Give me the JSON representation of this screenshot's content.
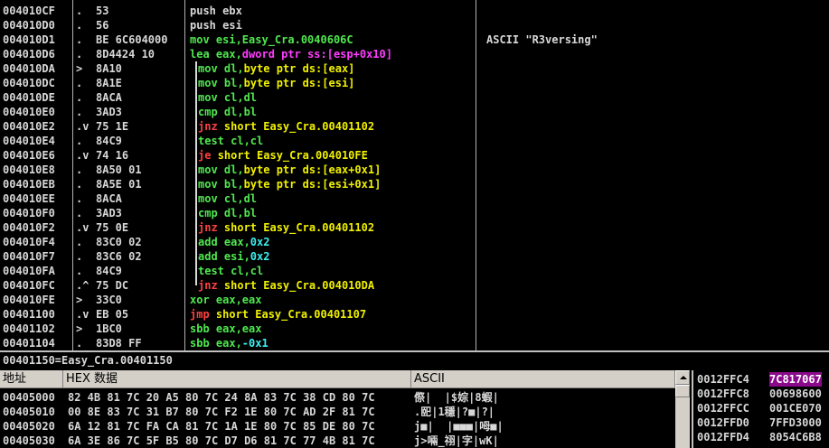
{
  "disasm": {
    "rows": [
      {
        "addr": "004010CF",
        "mark": ".",
        "hex": "53",
        "asm": [
          [
            "w",
            "push ebx"
          ]
        ],
        "comment": ""
      },
      {
        "addr": "004010D0",
        "mark": ".",
        "hex": "56",
        "asm": [
          [
            "w",
            "push esi"
          ]
        ],
        "comment": ""
      },
      {
        "addr": "004010D1",
        "mark": ".",
        "hex": "BE 6C604000",
        "asm": [
          [
            "g",
            "mov esi,Easy_Cra.0040606C"
          ]
        ],
        "comment": "ASCII \"R3versing\""
      },
      {
        "addr": "004010D6",
        "mark": ".",
        "hex": "8D4424 10",
        "asm": [
          [
            "g",
            "lea eax,"
          ],
          [
            "m",
            "dword ptr ss:[esp+0x10]"
          ]
        ],
        "comment": ""
      },
      {
        "addr": "004010DA",
        "mark": ">",
        "hex": "8A10",
        "asm": [
          [
            "g",
            "mov dl,"
          ],
          [
            "y",
            "byte ptr ds:[eax]"
          ]
        ],
        "comment": ""
      },
      {
        "addr": "004010DC",
        "mark": ".",
        "hex": "8A1E",
        "asm": [
          [
            "g",
            "mov bl,"
          ],
          [
            "y",
            "byte ptr ds:[esi]"
          ]
        ],
        "comment": ""
      },
      {
        "addr": "004010DE",
        "mark": ".",
        "hex": "8ACA",
        "asm": [
          [
            "g",
            "mov cl,dl"
          ]
        ],
        "comment": ""
      },
      {
        "addr": "004010E0",
        "mark": ".",
        "hex": "3AD3",
        "asm": [
          [
            "g",
            "cmp dl,bl"
          ]
        ],
        "comment": ""
      },
      {
        "addr": "004010E2",
        "mark": ".v",
        "hex": "75 1E",
        "asm": [
          [
            "r",
            "jnz "
          ],
          [
            "y",
            "short Easy_Cra.00401102"
          ]
        ],
        "comment": ""
      },
      {
        "addr": "004010E4",
        "mark": ".",
        "hex": "84C9",
        "asm": [
          [
            "g",
            "test cl,cl"
          ]
        ],
        "comment": ""
      },
      {
        "addr": "004010E6",
        "mark": ".v",
        "hex": "74 16",
        "asm": [
          [
            "r",
            "je "
          ],
          [
            "y",
            "short Easy_Cra.004010FE"
          ]
        ],
        "comment": ""
      },
      {
        "addr": "004010E8",
        "mark": ".",
        "hex": "8A50 01",
        "asm": [
          [
            "g",
            "mov dl,"
          ],
          [
            "y",
            "byte ptr ds:[eax+0x1]"
          ]
        ],
        "comment": ""
      },
      {
        "addr": "004010EB",
        "mark": ".",
        "hex": "8A5E 01",
        "asm": [
          [
            "g",
            "mov bl,"
          ],
          [
            "y",
            "byte ptr ds:[esi+0x1]"
          ]
        ],
        "comment": ""
      },
      {
        "addr": "004010EE",
        "mark": ".",
        "hex": "8ACA",
        "asm": [
          [
            "g",
            "mov cl,dl"
          ]
        ],
        "comment": ""
      },
      {
        "addr": "004010F0",
        "mark": ".",
        "hex": "3AD3",
        "asm": [
          [
            "g",
            "cmp dl,bl"
          ]
        ],
        "comment": ""
      },
      {
        "addr": "004010F2",
        "mark": ".v",
        "hex": "75 0E",
        "asm": [
          [
            "r",
            "jnz "
          ],
          [
            "y",
            "short Easy_Cra.00401102"
          ]
        ],
        "comment": ""
      },
      {
        "addr": "004010F4",
        "mark": ".",
        "hex": "83C0 02",
        "asm": [
          [
            "g",
            "add eax,"
          ],
          [
            "c",
            "0x2"
          ]
        ],
        "comment": ""
      },
      {
        "addr": "004010F7",
        "mark": ".",
        "hex": "83C6 02",
        "asm": [
          [
            "g",
            "add esi,"
          ],
          [
            "c",
            "0x2"
          ]
        ],
        "comment": ""
      },
      {
        "addr": "004010FA",
        "mark": ".",
        "hex": "84C9",
        "asm": [
          [
            "g",
            "test cl,cl"
          ]
        ],
        "comment": ""
      },
      {
        "addr": "004010FC",
        "mark": ".^",
        "hex": "75 DC",
        "asm": [
          [
            "r",
            "jnz "
          ],
          [
            "y",
            "short Easy_Cra.004010DA"
          ]
        ],
        "comment": ""
      },
      {
        "addr": "004010FE",
        "mark": ">",
        "hex": "33C0",
        "asm": [
          [
            "g",
            "xor eax,eax"
          ]
        ],
        "comment": ""
      },
      {
        "addr": "00401100",
        "mark": ".v",
        "hex": "EB 05",
        "asm": [
          [
            "r",
            "jmp "
          ],
          [
            "y",
            "short Easy_Cra.00401107"
          ]
        ],
        "comment": ""
      },
      {
        "addr": "00401102",
        "mark": ">",
        "hex": "1BC0",
        "asm": [
          [
            "g",
            "sbb eax,eax"
          ]
        ],
        "comment": ""
      },
      {
        "addr": "00401104",
        "mark": ".",
        "hex": "83D8 FF",
        "asm": [
          [
            "g",
            "sbb eax,"
          ],
          [
            "c",
            "-0x1"
          ]
        ],
        "comment": ""
      }
    ]
  },
  "info_line": "00401150=Easy_Cra.00401150",
  "dump": {
    "headers": {
      "address": "地址",
      "hex": "HEX 数据",
      "ascii": "ASCII"
    },
    "rows": [
      {
        "addr": "00405000",
        "hex": "82 4B 81 7C 20 A5 80 7C 24 8A 83 7C 38 CD 80 7C",
        "ascii": "傺|  |$婃|8蝦|"
      },
      {
        "addr": "00405010",
        "hex": "00 8E 83 7C 31 B7 80 7C F2 1E 80 7C AD 2F 81 7C",
        "ascii": ".巸|1穩|?■|?|"
      },
      {
        "addr": "00405020",
        "hex": "6A 12 81 7C FA CA 81 7C 1A 1E 80 7C 85 DE 80 7C",
        "ascii": "j■|  |■■■|呣■|"
      },
      {
        "addr": "00405030",
        "hex": "6A 3E 86 7C 5F B5 80 7C D7 D6 81 7C 77 4B 81 7C",
        "ascii": "j>啢_祤|字|wK|"
      }
    ]
  },
  "stack": {
    "rows": [
      {
        "addr": "0012FFC4",
        "val": "7C817067",
        "selected": true
      },
      {
        "addr": "0012FFC8",
        "val": "00698600",
        "selected": false
      },
      {
        "addr": "0012FFCC",
        "val": "001CE070",
        "selected": false
      },
      {
        "addr": "0012FFD0",
        "val": "7FFD3000",
        "selected": false
      },
      {
        "addr": "0012FFD4",
        "val": "8054C6B8",
        "selected": false
      }
    ]
  },
  "colors": {
    "white": "#d8d8d8",
    "green": "#4fe84f",
    "yellow": "#f0f000",
    "red": "#ff4040",
    "magenta": "#ff3cff",
    "cyan": "#3cf0f0"
  }
}
